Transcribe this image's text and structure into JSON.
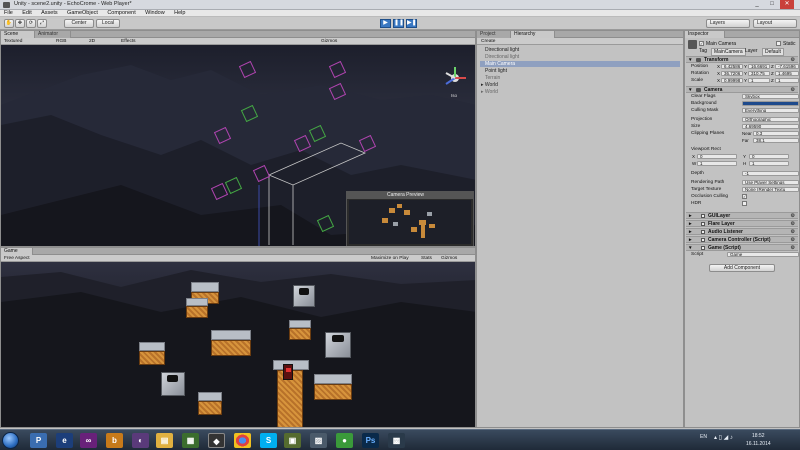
{
  "window": {
    "title": "Unity - scene2.unity - EchoCrome - Web Player*",
    "controls": [
      "_",
      "□",
      "✕"
    ]
  },
  "menu": [
    "File",
    "Edit",
    "Assets",
    "GameObject",
    "Component",
    "Window",
    "Help"
  ],
  "toolbar": {
    "center_label": "Center",
    "local_label": "Local",
    "layers_label": "Layers",
    "layout_label": "Layout"
  },
  "scene_panel": {
    "tabs": [
      "Scene",
      "Animator"
    ],
    "shading_mode": "Textured",
    "render_mode": "RGB",
    "two_d": "2D",
    "effects": "Effects",
    "gizmos": "Gizmos",
    "persp_label": "Iso",
    "camera_preview_title": "Camera Preview"
  },
  "game_panel": {
    "tab": "Game",
    "aspect": "Free Aspect",
    "maximize_on_play": "Maximize on Play",
    "stats": "Stats",
    "gizmos": "Gizmos"
  },
  "hierarchy_panel": {
    "tabs": [
      "Project",
      "Hierarchy"
    ],
    "create_label": "Create",
    "items": [
      {
        "label": "Directional light",
        "state": "normal"
      },
      {
        "label": "Directional light",
        "state": "dim"
      },
      {
        "label": "Main Camera",
        "state": "selected"
      },
      {
        "label": "Point light",
        "state": "normal"
      },
      {
        "label": "Terrain",
        "state": "dim"
      },
      {
        "label": "World",
        "state": "normal"
      },
      {
        "label": "World",
        "state": "dim"
      }
    ]
  },
  "inspector": {
    "tab": "Inspector",
    "object_name": "Main Camera",
    "static_label": "Static",
    "tag_label": "Tag",
    "tag_value": "MainCamera",
    "layer_label": "Layer",
    "layer_value": "Default",
    "transform": {
      "title": "Transform",
      "position": {
        "label": "Position",
        "x": "6.42586",
        "y": "16.6691",
        "z": "-7.61596"
      },
      "rotation": {
        "label": "Rotation",
        "x": "36.7206",
        "y": "310.75",
        "z": "1.4695"
      },
      "scale": {
        "label": "Scale",
        "x": "0.99998",
        "y": "1",
        "z": "1"
      }
    },
    "camera": {
      "title": "Camera",
      "clear_flags": {
        "label": "Clear Flags",
        "value": "Skybox"
      },
      "background": {
        "label": "Background",
        "color": "#1e4a8c"
      },
      "culling_mask": {
        "label": "Culling Mask",
        "value": "Everything"
      },
      "projection": {
        "label": "Projection",
        "value": "Orthographic"
      },
      "size": {
        "label": "Size",
        "value": "4.69590"
      },
      "clipping": {
        "label": "Clipping Planes",
        "near_label": "Near",
        "near": "0.3",
        "far_label": "Far",
        "far": "38.1"
      },
      "viewport": {
        "label": "Viewport Rect",
        "x_label": "X",
        "x": "0",
        "y_label": "Y",
        "y": "0",
        "w_label": "W",
        "w": "1",
        "h_label": "H",
        "h": "1"
      },
      "depth": {
        "label": "Depth",
        "value": "-1"
      },
      "rendering_path": {
        "label": "Rendering Path",
        "value": "Use Player Settings"
      },
      "target_texture": {
        "label": "Target Texture",
        "value": "None (Render Textu"
      },
      "occlusion_culling": {
        "label": "Occlusion Culling",
        "checked": true
      },
      "hdr": {
        "label": "HDR",
        "checked": false
      }
    },
    "components": [
      {
        "name": "GUILayer",
        "icon": "guilayer-icon"
      },
      {
        "name": "Flare Layer",
        "icon": "flare-icon"
      },
      {
        "name": "Audio Listener",
        "icon": "audio-listener-icon"
      },
      {
        "name": "Camera Controller (Script)",
        "icon": "script-icon"
      },
      {
        "name": "Game (Script)",
        "icon": "script-icon"
      }
    ],
    "script_row": {
      "label": "Script",
      "value": "Game"
    },
    "add_component_label": "Add Component"
  },
  "taskbar": {
    "apps": [
      "start",
      "ie",
      "P",
      "visual-studio",
      "b",
      "app5",
      "explorer",
      "unity",
      "chrome",
      "skype",
      "app11",
      "app12",
      "app13",
      "photoshop",
      "app15"
    ],
    "language": "EN",
    "time": "18:52",
    "date": "16.11.2014"
  },
  "colors": {
    "selection": "#8fa0c0",
    "play_blue": "#3a78c2"
  }
}
